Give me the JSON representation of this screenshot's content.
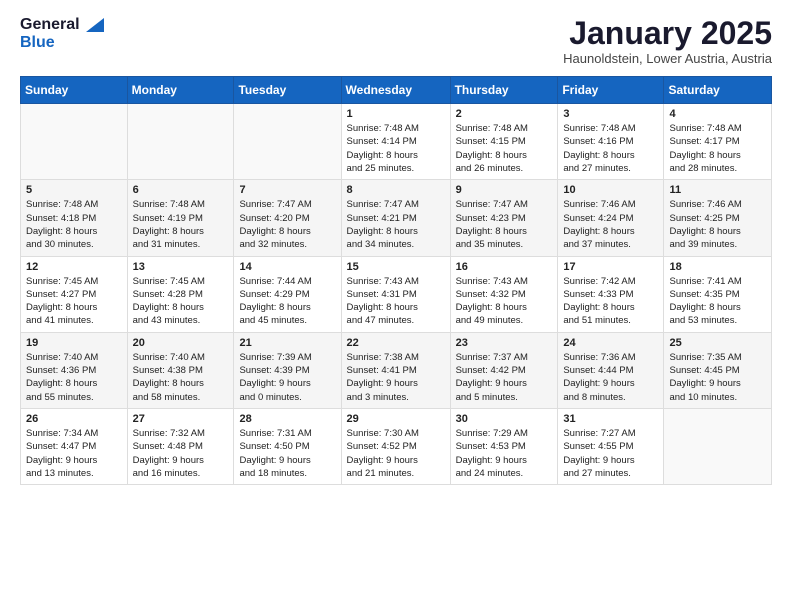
{
  "header": {
    "logo_general": "General",
    "logo_blue": "Blue",
    "month_title": "January 2025",
    "subtitle": "Haunoldstein, Lower Austria, Austria"
  },
  "weekdays": [
    "Sunday",
    "Monday",
    "Tuesday",
    "Wednesday",
    "Thursday",
    "Friday",
    "Saturday"
  ],
  "weeks": [
    [
      {
        "day": "",
        "info": ""
      },
      {
        "day": "",
        "info": ""
      },
      {
        "day": "",
        "info": ""
      },
      {
        "day": "1",
        "info": "Sunrise: 7:48 AM\nSunset: 4:14 PM\nDaylight: 8 hours\nand 25 minutes."
      },
      {
        "day": "2",
        "info": "Sunrise: 7:48 AM\nSunset: 4:15 PM\nDaylight: 8 hours\nand 26 minutes."
      },
      {
        "day": "3",
        "info": "Sunrise: 7:48 AM\nSunset: 4:16 PM\nDaylight: 8 hours\nand 27 minutes."
      },
      {
        "day": "4",
        "info": "Sunrise: 7:48 AM\nSunset: 4:17 PM\nDaylight: 8 hours\nand 28 minutes."
      }
    ],
    [
      {
        "day": "5",
        "info": "Sunrise: 7:48 AM\nSunset: 4:18 PM\nDaylight: 8 hours\nand 30 minutes."
      },
      {
        "day": "6",
        "info": "Sunrise: 7:48 AM\nSunset: 4:19 PM\nDaylight: 8 hours\nand 31 minutes."
      },
      {
        "day": "7",
        "info": "Sunrise: 7:47 AM\nSunset: 4:20 PM\nDaylight: 8 hours\nand 32 minutes."
      },
      {
        "day": "8",
        "info": "Sunrise: 7:47 AM\nSunset: 4:21 PM\nDaylight: 8 hours\nand 34 minutes."
      },
      {
        "day": "9",
        "info": "Sunrise: 7:47 AM\nSunset: 4:23 PM\nDaylight: 8 hours\nand 35 minutes."
      },
      {
        "day": "10",
        "info": "Sunrise: 7:46 AM\nSunset: 4:24 PM\nDaylight: 8 hours\nand 37 minutes."
      },
      {
        "day": "11",
        "info": "Sunrise: 7:46 AM\nSunset: 4:25 PM\nDaylight: 8 hours\nand 39 minutes."
      }
    ],
    [
      {
        "day": "12",
        "info": "Sunrise: 7:45 AM\nSunset: 4:27 PM\nDaylight: 8 hours\nand 41 minutes."
      },
      {
        "day": "13",
        "info": "Sunrise: 7:45 AM\nSunset: 4:28 PM\nDaylight: 8 hours\nand 43 minutes."
      },
      {
        "day": "14",
        "info": "Sunrise: 7:44 AM\nSunset: 4:29 PM\nDaylight: 8 hours\nand 45 minutes."
      },
      {
        "day": "15",
        "info": "Sunrise: 7:43 AM\nSunset: 4:31 PM\nDaylight: 8 hours\nand 47 minutes."
      },
      {
        "day": "16",
        "info": "Sunrise: 7:43 AM\nSunset: 4:32 PM\nDaylight: 8 hours\nand 49 minutes."
      },
      {
        "day": "17",
        "info": "Sunrise: 7:42 AM\nSunset: 4:33 PM\nDaylight: 8 hours\nand 51 minutes."
      },
      {
        "day": "18",
        "info": "Sunrise: 7:41 AM\nSunset: 4:35 PM\nDaylight: 8 hours\nand 53 minutes."
      }
    ],
    [
      {
        "day": "19",
        "info": "Sunrise: 7:40 AM\nSunset: 4:36 PM\nDaylight: 8 hours\nand 55 minutes."
      },
      {
        "day": "20",
        "info": "Sunrise: 7:40 AM\nSunset: 4:38 PM\nDaylight: 8 hours\nand 58 minutes."
      },
      {
        "day": "21",
        "info": "Sunrise: 7:39 AM\nSunset: 4:39 PM\nDaylight: 9 hours\nand 0 minutes."
      },
      {
        "day": "22",
        "info": "Sunrise: 7:38 AM\nSunset: 4:41 PM\nDaylight: 9 hours\nand 3 minutes."
      },
      {
        "day": "23",
        "info": "Sunrise: 7:37 AM\nSunset: 4:42 PM\nDaylight: 9 hours\nand 5 minutes."
      },
      {
        "day": "24",
        "info": "Sunrise: 7:36 AM\nSunset: 4:44 PM\nDaylight: 9 hours\nand 8 minutes."
      },
      {
        "day": "25",
        "info": "Sunrise: 7:35 AM\nSunset: 4:45 PM\nDaylight: 9 hours\nand 10 minutes."
      }
    ],
    [
      {
        "day": "26",
        "info": "Sunrise: 7:34 AM\nSunset: 4:47 PM\nDaylight: 9 hours\nand 13 minutes."
      },
      {
        "day": "27",
        "info": "Sunrise: 7:32 AM\nSunset: 4:48 PM\nDaylight: 9 hours\nand 16 minutes."
      },
      {
        "day": "28",
        "info": "Sunrise: 7:31 AM\nSunset: 4:50 PM\nDaylight: 9 hours\nand 18 minutes."
      },
      {
        "day": "29",
        "info": "Sunrise: 7:30 AM\nSunset: 4:52 PM\nDaylight: 9 hours\nand 21 minutes."
      },
      {
        "day": "30",
        "info": "Sunrise: 7:29 AM\nSunset: 4:53 PM\nDaylight: 9 hours\nand 24 minutes."
      },
      {
        "day": "31",
        "info": "Sunrise: 7:27 AM\nSunset: 4:55 PM\nDaylight: 9 hours\nand 27 minutes."
      },
      {
        "day": "",
        "info": ""
      }
    ]
  ]
}
